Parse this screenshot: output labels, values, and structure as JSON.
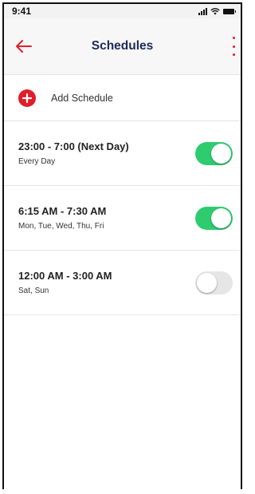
{
  "status_bar": {
    "time": "9:41"
  },
  "header": {
    "title": "Schedules",
    "back_icon": "arrow-left-icon",
    "menu_icon": "kebab-menu-icon",
    "accent_color": "#e11d2a",
    "title_color": "#1f2a5a"
  },
  "add_schedule": {
    "label": "Add Schedule",
    "icon": "plus-icon"
  },
  "schedules": [
    {
      "time": "23:00 - 7:00 (Next Day)",
      "days": "Every Day",
      "enabled": true
    },
    {
      "time": "6:15 AM - 7:30 AM",
      "days": "Mon, Tue, Wed, Thu, Fri",
      "enabled": true
    },
    {
      "time": "12:00 AM - 3:00 AM",
      "days": "Sat, Sun",
      "enabled": false
    }
  ],
  "colors": {
    "toggle_on": "#2ecc6f",
    "toggle_off": "#e6e6e6"
  }
}
